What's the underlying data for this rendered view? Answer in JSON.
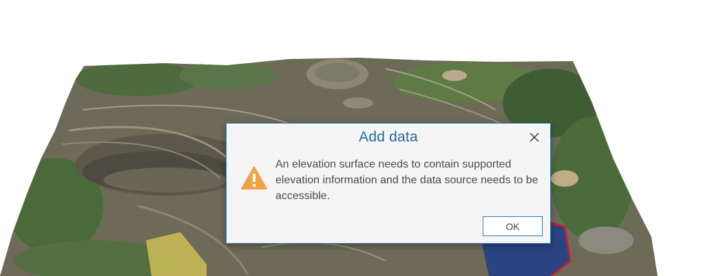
{
  "scene": {
    "description_icon": "terrain-map"
  },
  "dialog": {
    "title": "Add data",
    "message": "An elevation surface needs to contain supported elevation information and the data source needs to be accessible.",
    "ok_label": "OK",
    "icon": "warning-icon",
    "close_icon": "close-icon"
  },
  "colors": {
    "title": "#2068a3",
    "border": "#2e7ab0",
    "warning": "#f0a24b",
    "background": "#f5f5f5"
  }
}
